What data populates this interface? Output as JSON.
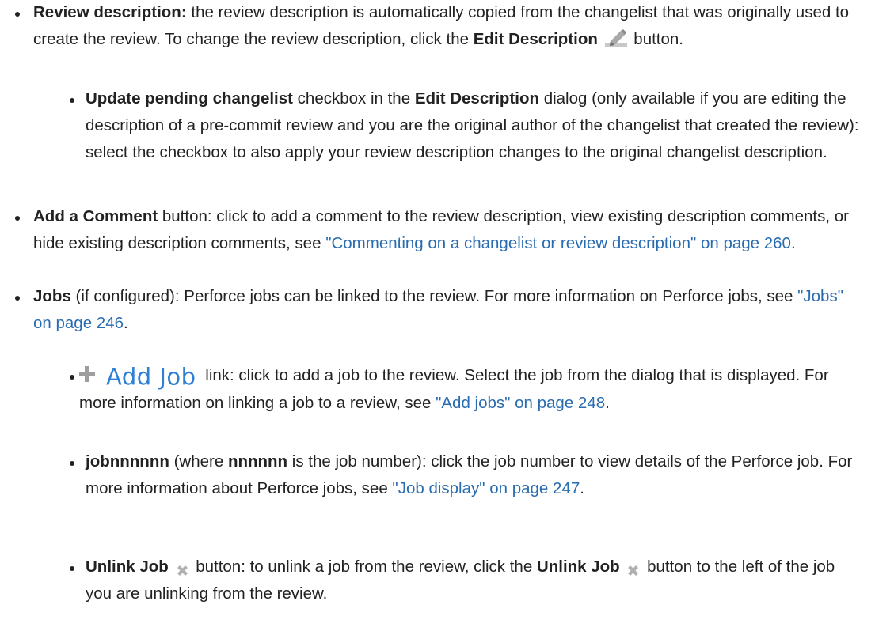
{
  "items": {
    "review_description": {
      "label": "Review description:",
      "text1": " the review description is automatically copied from the changelist that was originally used to create the review. To change the review description, click the ",
      "edit_bold": "Edit Description",
      "text2": " button."
    },
    "update_pending": {
      "label": "Update pending changelist",
      "text1": " checkbox in the ",
      "dialog_bold": "Edit Description",
      "text2": " dialog (only available if you are editing the description of a pre-commit review and you are the original author of the changelist that created the review): select the checkbox to also apply your review description changes to the original changelist description."
    },
    "add_comment": {
      "label": "Add a Comment",
      "text1": " button: click to add a comment to the review description, view existing description comments, or hide existing description comments, see ",
      "link": "\"Commenting on a changelist or review description\" on page 260",
      "text2": "."
    },
    "jobs": {
      "label": "Jobs",
      "text1": " (if configured): Perforce jobs can be linked to the review. For more information on Perforce jobs, see ",
      "link": "\"Jobs\" on page 246",
      "text2": "."
    },
    "add_job": {
      "label": "Add Job",
      "text1": " link: click to add a job to the review. Select the job from the dialog that is displayed. For more information on linking a job to a review, see ",
      "link": "\"Add jobs\" on page 248",
      "text2": "."
    },
    "job_number": {
      "label": "jobnnnnnn",
      "text1": " (where ",
      "nn_bold": "nnnnnn",
      "text2": " is the job number): click the job number to view details of the Perforce job. For more information about Perforce jobs, see ",
      "link": "\"Job display\" on page 247",
      "text3": "."
    },
    "unlink_job": {
      "label": "Unlink Job",
      "text1": " button: to unlink a job from the review, click the ",
      "label2": "Unlink Job",
      "text2": " button to the left of the job you are unlinking from the review."
    }
  },
  "colors": {
    "text": "#222222",
    "link": "#2a6cb0",
    "add_job_link": "#2e7fd6",
    "icon_gray": "#b0b0b0"
  },
  "icons": {
    "edit": "pencil-icon",
    "add": "plus-icon",
    "unlink": "x-icon"
  }
}
